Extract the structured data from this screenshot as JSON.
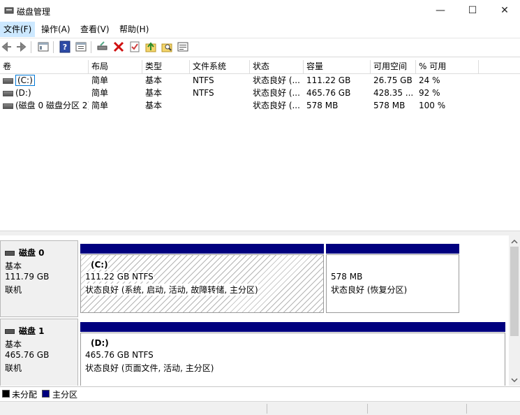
{
  "window": {
    "title": "磁盘管理",
    "minimize_glyph": "—",
    "maximize_glyph": "☐",
    "close_glyph": "✕"
  },
  "menu": {
    "items": [
      "文件(F)",
      "操作(A)",
      "查看(V)",
      "帮助(H)"
    ],
    "active_index": 0
  },
  "toolbar": {
    "icons": [
      "back-icon",
      "forward-icon",
      "console-tree-icon",
      "help-icon",
      "properties-icon",
      "connect-drive-icon",
      "delete-icon",
      "check-icon",
      "up-icon",
      "search-icon",
      "list-icon"
    ]
  },
  "volume_list": {
    "columns": [
      "卷",
      "布局",
      "类型",
      "文件系统",
      "状态",
      "容量",
      "可用空间",
      "% 可用"
    ],
    "rows": [
      {
        "volume": "(C:)",
        "layout": "简单",
        "type": "基本",
        "fs": "NTFS",
        "status": "状态良好 (...",
        "capacity": "111.22 GB",
        "free": "26.75 GB",
        "pct": "24 %",
        "selected": true
      },
      {
        "volume": "(D:)",
        "layout": "简单",
        "type": "基本",
        "fs": "NTFS",
        "status": "状态良好 (...",
        "capacity": "465.76 GB",
        "free": "428.35 ...",
        "pct": "92 %",
        "selected": false
      },
      {
        "volume": "(磁盘 0 磁盘分区 2)",
        "layout": "简单",
        "type": "基本",
        "fs": "",
        "status": "状态良好 (...",
        "capacity": "578 MB",
        "free": "578 MB",
        "pct": "100 %",
        "selected": false
      }
    ]
  },
  "disks": [
    {
      "name": "磁盘 0",
      "type": "基本",
      "size": "111.79 GB",
      "status": "联机",
      "partitions": [
        {
          "label": "(C:)",
          "size_fs": "111.22 GB NTFS",
          "status": "状态良好 (系统, 启动, 活动, 故障转储, 主分区)",
          "hatched": true
        },
        {
          "label": "",
          "size_fs": "578 MB",
          "status": "状态良好 (恢复分区)",
          "hatched": false
        }
      ]
    },
    {
      "name": "磁盘 1",
      "type": "基本",
      "size": "465.76 GB",
      "status": "联机",
      "partitions": [
        {
          "label": "(D:)",
          "size_fs": "465.76 GB NTFS",
          "status": "状态良好 (页面文件, 活动, 主分区)",
          "hatched": false
        }
      ]
    }
  ],
  "legend": {
    "items": [
      {
        "label": "未分配",
        "color": "#000000"
      },
      {
        "label": "主分区",
        "color": "#00007f"
      }
    ]
  }
}
